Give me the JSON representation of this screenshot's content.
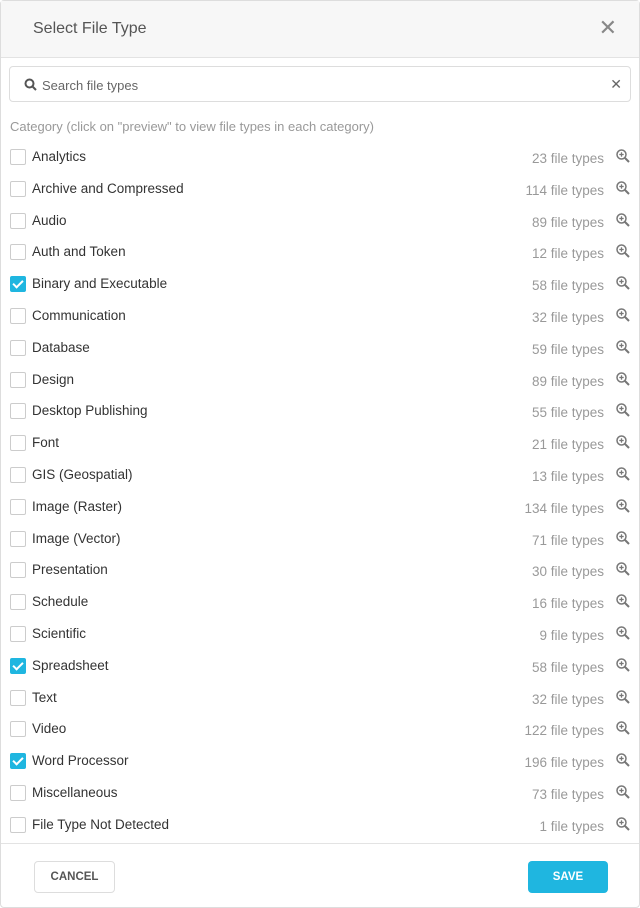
{
  "dialog": {
    "title": "Select File Type"
  },
  "search": {
    "placeholder": "Search file types",
    "value": ""
  },
  "category_label": "Category (click on \"preview\" to view file types in each category)",
  "categories": [
    {
      "name": "Analytics",
      "count": "23 file types",
      "checked": false
    },
    {
      "name": "Archive and Compressed",
      "count": "114 file types",
      "checked": false
    },
    {
      "name": "Audio",
      "count": "89 file types",
      "checked": false
    },
    {
      "name": "Auth and Token",
      "count": "12 file types",
      "checked": false
    },
    {
      "name": "Binary and Executable",
      "count": "58 file types",
      "checked": true
    },
    {
      "name": "Communication",
      "count": "32 file types",
      "checked": false
    },
    {
      "name": "Database",
      "count": "59 file types",
      "checked": false
    },
    {
      "name": "Design",
      "count": "89 file types",
      "checked": false
    },
    {
      "name": "Desktop Publishing",
      "count": "55 file types",
      "checked": false
    },
    {
      "name": "Font",
      "count": "21 file types",
      "checked": false
    },
    {
      "name": "GIS (Geospatial)",
      "count": "13 file types",
      "checked": false
    },
    {
      "name": "Image (Raster)",
      "count": "134 file types",
      "checked": false
    },
    {
      "name": "Image (Vector)",
      "count": "71 file types",
      "checked": false
    },
    {
      "name": "Presentation",
      "count": "30 file types",
      "checked": false
    },
    {
      "name": "Schedule",
      "count": "16 file types",
      "checked": false
    },
    {
      "name": "Scientific",
      "count": "9 file types",
      "checked": false
    },
    {
      "name": "Spreadsheet",
      "count": "58 file types",
      "checked": true
    },
    {
      "name": "Text",
      "count": "32 file types",
      "checked": false
    },
    {
      "name": "Video",
      "count": "122 file types",
      "checked": false
    },
    {
      "name": "Word Processor",
      "count": "196 file types",
      "checked": true
    },
    {
      "name": "Miscellaneous",
      "count": "73 file types",
      "checked": false
    },
    {
      "name": "File Type Not Detected",
      "count": "1 file types",
      "checked": false
    }
  ],
  "footer": {
    "cancel_label": "CANCEL",
    "save_label": "SAVE"
  },
  "colors": {
    "accent": "#1fb6e0"
  }
}
